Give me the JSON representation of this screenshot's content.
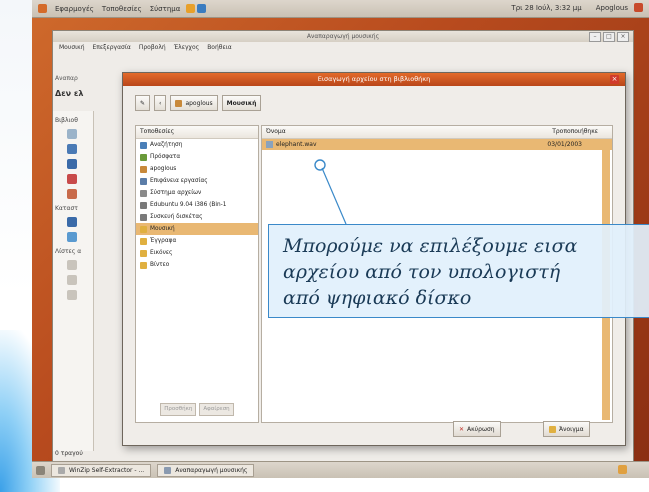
{
  "top_panel": {
    "menus": [
      "Εφαρμογές",
      "Τοποθεσίες",
      "Σύστημα"
    ],
    "clock": "Τρι 28 Ιούλ, 3:32 μμ",
    "user": "Αpoglous"
  },
  "app_window": {
    "title": "Αναπαραγωγή μουσικής",
    "menu": [
      "Μουσική",
      "Επεξεργασία",
      "Προβολή",
      "Έλεγχος",
      "Βοήθεια"
    ],
    "toolbar_hint": "Αναπαρ",
    "header": "Δεν ελ",
    "sidebar_labels": [
      "Βιβλιοθ",
      "Καταστ",
      "Λίστες α"
    ],
    "footer": "0 τραγού"
  },
  "dialog": {
    "title": "Εισαγωγή αρχείου στη βιβλιοθήκη",
    "path": [
      "apoglous",
      "Μουσική"
    ],
    "places_header": "Τοποθεσίες",
    "places": [
      {
        "label": "Αναζήτηση",
        "color": "#4a7fb8"
      },
      {
        "label": "Πρόσφατα",
        "color": "#6a9a3a"
      },
      {
        "label": "apoglous",
        "color": "#c8893a"
      },
      {
        "label": "Επιφάνεια εργασίας",
        "color": "#5b7da8"
      },
      {
        "label": "Σύστημα αρχείων",
        "color": "#8a8a8a"
      },
      {
        "label": "Edubuntu 9.04 i386 (Bin-1",
        "color": "#7a7a7a"
      },
      {
        "label": "Συσκευή δισκέτας",
        "color": "#7a7a7a"
      },
      {
        "label": "Μουσική",
        "color": "#e0b040"
      },
      {
        "label": "Έγγραφα",
        "color": "#e0b040"
      },
      {
        "label": "Εικόνες",
        "color": "#e0b040"
      },
      {
        "label": "Βίντεο",
        "color": "#e0b040"
      }
    ],
    "selected_place_index": 7,
    "add_label": "Προσθήκη",
    "remove_label": "Αφαίρεση",
    "col_name": "Όνομα",
    "col_modified": "Τροποποιήθηκε",
    "file_name": "elephant.wav",
    "file_date": "03/01/2003",
    "cancel_label": "Ακύρωση",
    "open_label": "Άνοιγμα"
  },
  "callout": {
    "line1": "Μπορούμε να επιλέξουμε εισα",
    "line2": "αρχείου από τον υπολογιστή",
    "line3": "από ψηφιακό δίσκο"
  },
  "taskbar": {
    "items": [
      "WinZip Self-Extractor - ...",
      "Αναπαραγωγή μουσικής"
    ]
  },
  "colors": {
    "accent_orange": "#b9461a",
    "selection": "#e9b873",
    "callout_border": "#3a89c9"
  }
}
